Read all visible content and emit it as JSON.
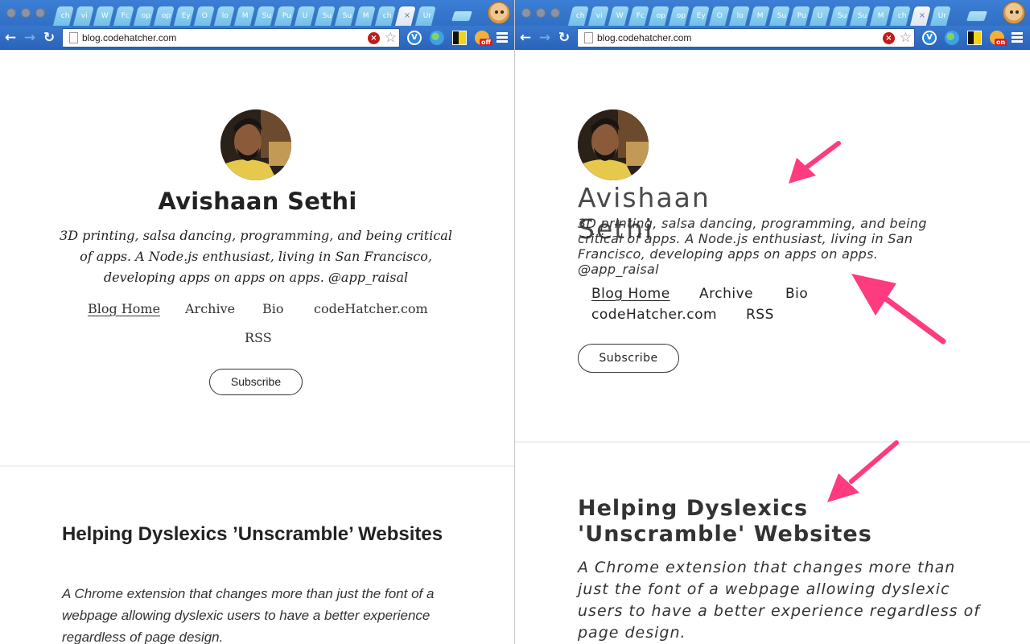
{
  "browser": {
    "tabs": [
      "ch",
      "vi",
      "W",
      "Fc",
      "op",
      "op",
      "Ey",
      "O",
      "lo",
      "M",
      "Su",
      "Pu",
      "U",
      "Su",
      "Su",
      "M",
      "ch",
      "",
      "Ur"
    ],
    "active_tab_index": 17,
    "active_tab_close": "×",
    "url": "blog.codehatcher.com",
    "stop_icon": "×",
    "star_icon": "☆",
    "extension_v_label": "V",
    "extension_eye_label_left": "off",
    "extension_eye_label_right": "on"
  },
  "profile": {
    "name": "Avishaan Sethi",
    "bio": "3D printing, salsa dancing, programming, and being critical of apps. A Node.js enthusiast, living in San Francisco, developing apps on apps on apps. @app_raisal"
  },
  "nav": {
    "items": [
      "Blog Home",
      "Archive",
      "Bio",
      "codeHatcher.com",
      "RSS"
    ]
  },
  "subscribe_label": "Subscribe",
  "post": {
    "title_left": "Helping Dyslexics ’Unscramble’ Websites",
    "title_right": "Helping Dyslexics 'Unscramble' Websites",
    "description": "A Chrome extension that changes more than just the font of a webpage allowing dyslexic users to have a better experience regardless of page design."
  },
  "colors": {
    "chrome_blue": "#2f6fc4",
    "annotation_arrow": "#ff3b7f"
  }
}
